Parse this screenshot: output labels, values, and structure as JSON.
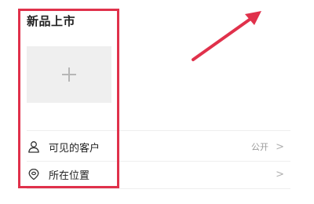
{
  "post": {
    "title": "新品上市"
  },
  "settings": {
    "visibility": {
      "icon": "person-icon",
      "label": "可见的客户",
      "value": "公开",
      "chevron": ">"
    },
    "location": {
      "icon": "location-pin-icon",
      "label": "所在位置",
      "chevron": ">"
    }
  },
  "annotations": {
    "highlight_color": "#e0314b",
    "arrow_color": "#e0314b"
  }
}
